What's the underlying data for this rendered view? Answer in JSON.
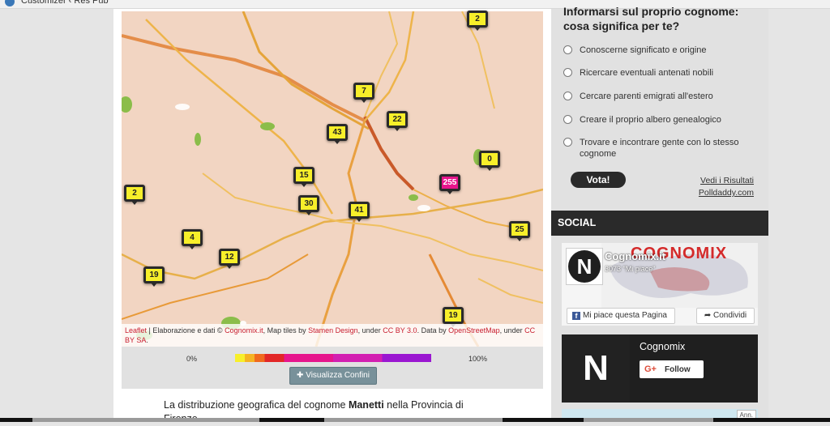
{
  "browser_tab": {
    "title": "Customizer ‹ Res Pub"
  },
  "map": {
    "markers": [
      {
        "label": "2",
        "hot": false
      },
      {
        "label": "7",
        "hot": false
      },
      {
        "label": "22",
        "hot": false
      },
      {
        "label": "43",
        "hot": false
      },
      {
        "label": "0",
        "hot": false
      },
      {
        "label": "15",
        "hot": false
      },
      {
        "label": "255",
        "hot": true
      },
      {
        "label": "2",
        "hot": false
      },
      {
        "label": "30",
        "hot": false
      },
      {
        "label": "41",
        "hot": false
      },
      {
        "label": "25",
        "hot": false
      },
      {
        "label": "4",
        "hot": false
      },
      {
        "label": "12",
        "hot": false
      },
      {
        "label": "19",
        "hot": false
      },
      {
        "label": "19",
        "hot": false
      }
    ],
    "attribution": {
      "leaflet": "Leaflet",
      "text1": " | Elaborazione e dati © ",
      "cognomix": "Cognomix.it",
      "text2": ", Map tiles by ",
      "stamen": "Stamen Design",
      "text3": ", under ",
      "ccby30": "CC BY 3.0",
      "text4": ". Data by ",
      "osm": "OpenStreetMap",
      "text5": ", under ",
      "ccbysa": "CC BY SA",
      "text6": "."
    }
  },
  "legend": {
    "min_label": "0%",
    "max_label": "100%",
    "visualizza_btn": "✚ Visualizza Confini"
  },
  "description": {
    "prefix": "La distribuzione geografica del cognome ",
    "surname": "Manetti",
    "suffix": " nella Provincia di Firenze"
  },
  "poll": {
    "question": "Informarsi sul proprio cognome: cosa significa per te?",
    "options": [
      "Conoscerne significato e origine",
      "Ricercare eventuali antenati nobili",
      "Cercare parenti emigrati all'estero",
      "Creare il proprio albero genealogico",
      "Trovare e incontrare gente con lo stesso cognome"
    ],
    "vote_label": "Vota!",
    "results_label": "Vedi i Risultati",
    "polldaddy_label": "Polldaddy.com"
  },
  "social": {
    "header": "SOCIAL",
    "facebook": {
      "brand": "COGNOMIX",
      "name": "Cognomix.it",
      "likes": "3073 \"Mi piace\"",
      "like_label": "Mi piace questa Pagina",
      "share_label": "Condividi"
    },
    "gplus": {
      "name": "Cognomix",
      "follow_label": "Follow",
      "logo_letter": "N"
    }
  },
  "ad": {
    "ann_label": "Ann."
  }
}
